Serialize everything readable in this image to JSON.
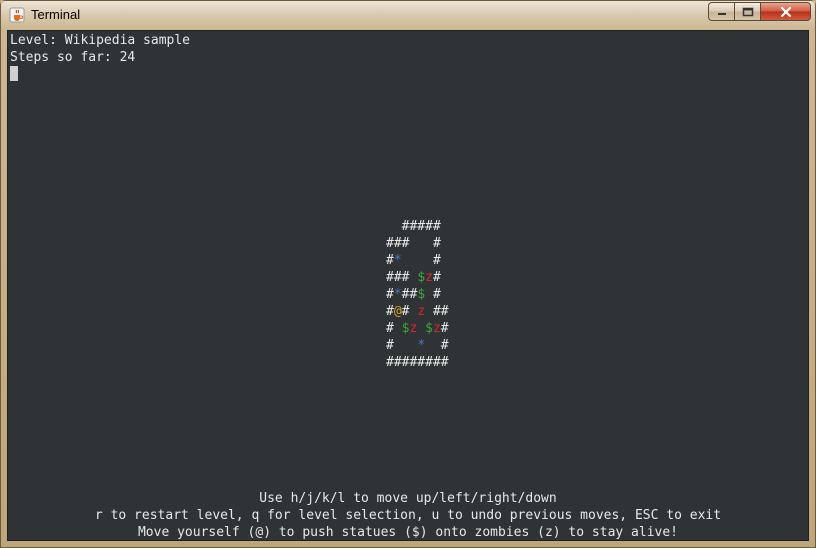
{
  "window": {
    "title": "Terminal",
    "buttons": {
      "minimize": "—",
      "maximize": "□",
      "close": "✕"
    }
  },
  "header": {
    "level_line": "Level: Wikipedia sample",
    "steps_line": "Steps so far: 24"
  },
  "board": {
    "rows": [
      [
        {
          "t": "  #####",
          "c": "wall"
        }
      ],
      [
        {
          "t": "###   #",
          "c": "wall"
        }
      ],
      [
        {
          "t": "#",
          "c": "wall"
        },
        {
          "t": "*",
          "c": "goal"
        },
        {
          "t": "    #",
          "c": "wall"
        }
      ],
      [
        {
          "t": "### ",
          "c": "wall"
        },
        {
          "t": "$",
          "c": "statue"
        },
        {
          "t": "z",
          "c": "zombie"
        },
        {
          "t": "#",
          "c": "wall"
        }
      ],
      [
        {
          "t": "#",
          "c": "wall"
        },
        {
          "t": "*",
          "c": "goal"
        },
        {
          "t": "##",
          "c": "wall"
        },
        {
          "t": "$",
          "c": "statue"
        },
        {
          "t": " #",
          "c": "wall"
        }
      ],
      [
        {
          "t": "#",
          "c": "wall"
        },
        {
          "t": "@",
          "c": "player"
        },
        {
          "t": "# ",
          "c": "wall"
        },
        {
          "t": "z",
          "c": "zombie"
        },
        {
          "t": " ##",
          "c": "wall"
        }
      ],
      [
        {
          "t": "# ",
          "c": "wall"
        },
        {
          "t": "$",
          "c": "statue"
        },
        {
          "t": "z",
          "c": "zombie"
        },
        {
          "t": " ",
          "c": "wall"
        },
        {
          "t": "$",
          "c": "statue"
        },
        {
          "t": "z",
          "c": "zombie"
        },
        {
          "t": "#",
          "c": "wall"
        }
      ],
      [
        {
          "t": "#   ",
          "c": "wall"
        },
        {
          "t": "*",
          "c": "goal"
        },
        {
          "t": "  #",
          "c": "wall"
        }
      ],
      [
        {
          "t": "########",
          "c": "wall"
        }
      ]
    ]
  },
  "footer": {
    "line1": "Use h/j/k/l to move up/left/right/down",
    "line2": "r to restart level, q for level selection, u to undo previous moves, ESC to exit",
    "line3": "Move yourself (@) to push statues ($) onto zombies (z) to stay alive!"
  },
  "colors": {
    "background": "#2f3335",
    "text": "#e8e8e8",
    "goal": "#4a78c8",
    "statue": "#3aa83a",
    "zombie": "#d02a2a",
    "player": "#d8a020"
  }
}
